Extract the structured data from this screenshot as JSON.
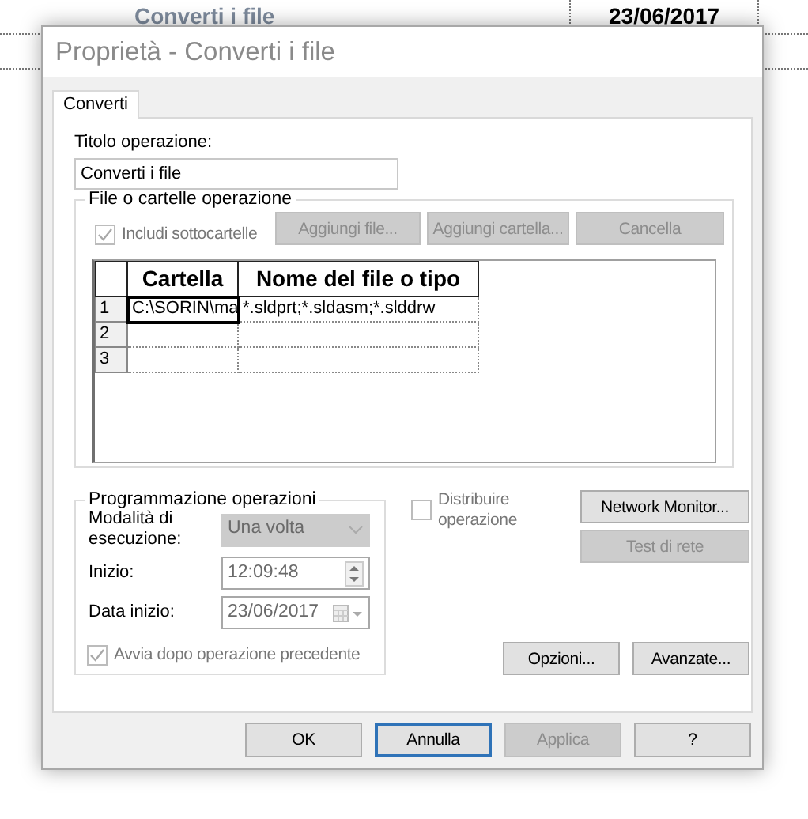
{
  "background": {
    "task_name": "Converti i file",
    "date": "23/06/2017"
  },
  "window": {
    "title": "Proprietà - Converti i file"
  },
  "tabs": [
    {
      "label": "Converti",
      "selected": true
    }
  ],
  "title_field": {
    "label": "Titolo operazione:",
    "value": "Converti i file"
  },
  "files_group": {
    "legend": "File o cartelle operazione",
    "include_subfolders": {
      "label": "Includi sottocartelle",
      "checked": true,
      "disabled": true
    },
    "buttons": [
      {
        "label": "Aggiungi file...",
        "disabled": true
      },
      {
        "label": "Aggiungi cartella...",
        "disabled": true
      },
      {
        "label": "Cancella",
        "disabled": true
      }
    ],
    "table": {
      "columns": [
        "Cartella",
        "Nome del file o tipo"
      ],
      "rows": [
        {
          "number": "1",
          "cells": [
            {
              "text": "C:\\SORIN\\ma",
              "selected": true
            },
            {
              "text": "*.sldprt;*.sldasm;*.slddrw",
              "selected": false
            }
          ]
        },
        {
          "number": "2"
        },
        {
          "number": "3"
        }
      ]
    }
  },
  "schedule_group": {
    "legend": "Programmazione operazioni",
    "fields": [
      {
        "kind": "select",
        "label": "Modalità di esecuzione:",
        "value": "Una volta",
        "disabled": true
      },
      {
        "kind": "time",
        "label": "Inizio:",
        "value": "12:09:48",
        "disabled": true
      },
      {
        "kind": "date",
        "label": "Data inizio:",
        "value": "23/06/2017",
        "disabled": true
      }
    ],
    "start_after_previous": {
      "label": "Avvia dopo operazione precedente",
      "checked": true,
      "disabled": true
    }
  },
  "distribute": {
    "label": "Distribuire operazione",
    "checked": false,
    "disabled": true
  },
  "side_buttons": [
    {
      "label": "Network Monitor...",
      "disabled": false
    },
    {
      "label": "Test di rete",
      "disabled": true
    }
  ],
  "panel_buttons": [
    {
      "label": "Opzioni...",
      "disabled": false
    },
    {
      "label": "Avanzate...",
      "disabled": false
    }
  ],
  "dialog_buttons": [
    {
      "label": "OK",
      "disabled": false,
      "focused": false
    },
    {
      "label": "Annulla",
      "disabled": false,
      "focused": true
    },
    {
      "label": "Applica",
      "disabled": true,
      "focused": false
    },
    {
      "label": "?",
      "disabled": false,
      "focused": false
    }
  ]
}
